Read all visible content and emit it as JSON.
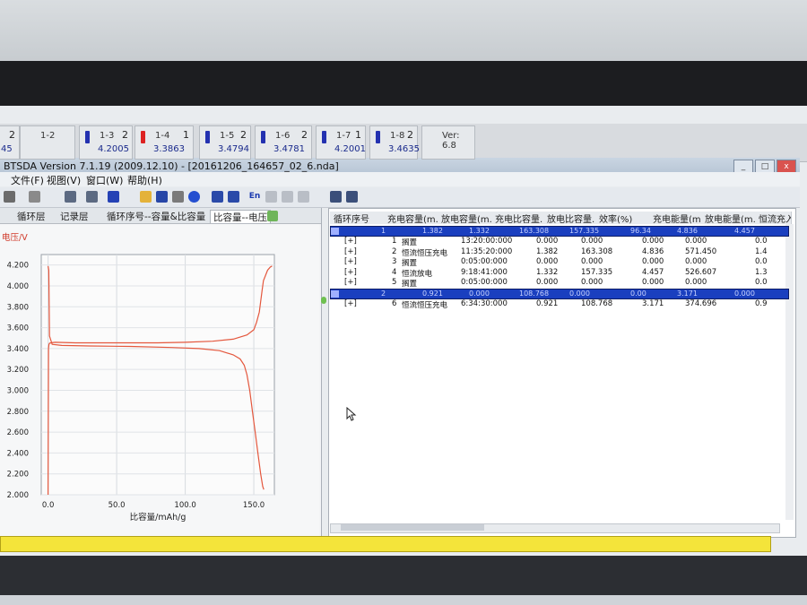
{
  "channel_tabs": [
    {
      "label": "",
      "num": "2",
      "volt": "45",
      "battery": "none"
    },
    {
      "label": "1-2",
      "num": "",
      "volt": "",
      "battery": "none"
    },
    {
      "label": "1-3",
      "num": "2",
      "volt": "4.2005",
      "battery": "blue"
    },
    {
      "label": "1-4",
      "num": "1",
      "volt": "3.3863",
      "battery": "red"
    },
    {
      "label": "1-5",
      "num": "2",
      "volt": "3.4794",
      "battery": "blue"
    },
    {
      "label": "1-6",
      "num": "2",
      "volt": "3.4781",
      "battery": "blue"
    },
    {
      "label": "1-7",
      "num": "1",
      "volt": "4.2001",
      "battery": "blue"
    },
    {
      "label": "1-8",
      "num": "2",
      "volt": "3.4635",
      "battery": "blue"
    },
    {
      "label": "Ver: 6.8",
      "num": "",
      "volt": "",
      "battery": "none"
    }
  ],
  "window": {
    "title": "BTSDA Version 7.1.19 (2009.12.10)   - [20161206_164657_02_6.nda]",
    "min": "_",
    "max": "□",
    "close": "x"
  },
  "menu": [
    "文件(F)",
    "视图(V)",
    "窗口(W)",
    "帮助(H)"
  ],
  "tabs": [
    "循环层",
    "记录层",
    "循环序号--容量&比容量",
    "比容量--电压"
  ],
  "active_tab": 3,
  "table": {
    "headers": [
      "循环序号",
      "充电容量(m...",
      "放电容量(m...",
      "充电比容量...",
      "放电比容量...",
      "效率(%)",
      "充电能量(m...",
      "放电能量(m...",
      "恒流充入比"
    ],
    "cycles": [
      {
        "summary": [
          "1",
          "1.382",
          "1.332",
          "163.308",
          "157.335",
          "96.34",
          "4.836",
          "4.457"
        ],
        "steps": [
          {
            "expand": "[+]",
            "idx": "1",
            "name": "搁置",
            "time": "13:20:00:000",
            "v1": "0.000",
            "v2": "0.000",
            "v3": "0.000",
            "v4": "0.000",
            "v5": "0.0"
          },
          {
            "expand": "[+]",
            "idx": "2",
            "name": "恒流恒压充电",
            "time": "11:35:20:000",
            "v1": "1.382",
            "v2": "163.308",
            "v3": "4.836",
            "v4": "571.450",
            "v5": "1.4"
          },
          {
            "expand": "[+]",
            "idx": "3",
            "name": "搁置",
            "time": "0:05:00:000",
            "v1": "0.000",
            "v2": "0.000",
            "v3": "0.000",
            "v4": "0.000",
            "v5": "0.0"
          },
          {
            "expand": "[+]",
            "idx": "4",
            "name": "恒流放电",
            "time": "9:18:41:000",
            "v1": "1.332",
            "v2": "157.335",
            "v3": "4.457",
            "v4": "526.607",
            "v5": "1.3"
          },
          {
            "expand": "[+]",
            "idx": "5",
            "name": "搁置",
            "time": "0:05:00:000",
            "v1": "0.000",
            "v2": "0.000",
            "v3": "0.000",
            "v4": "0.000",
            "v5": "0.0"
          }
        ]
      },
      {
        "summary": [
          "2",
          "0.921",
          "0.000",
          "108.768",
          "0.000",
          "0.00",
          "3.171",
          "0.000"
        ],
        "steps": [
          {
            "expand": "[+]",
            "idx": "6",
            "name": "恒流恒压充电",
            "time": "6:34:30:000",
            "v1": "0.921",
            "v2": "108.768",
            "v3": "3.171",
            "v4": "374.696",
            "v5": "0.9"
          }
        ]
      }
    ]
  },
  "chart_data": {
    "type": "line",
    "title": "",
    "xlabel": "比容量/mAh/g",
    "ylabel": "电压/V",
    "xlim": [
      -5,
      165
    ],
    "ylim": [
      2.0,
      4.3
    ],
    "x_ticks": [
      "0.0",
      "50.0",
      "100.0",
      "150.0"
    ],
    "x_tick_values": [
      0,
      50,
      100,
      150
    ],
    "y_ticks": [
      "4.200",
      "4.000",
      "3.800",
      "3.600",
      "3.400",
      "3.200",
      "3.000",
      "2.800",
      "2.600",
      "2.400",
      "2.200",
      "2.000"
    ],
    "y_tick_values": [
      4.2,
      4.0,
      3.8,
      3.6,
      3.4,
      3.2,
      3.0,
      2.8,
      2.6,
      2.4,
      2.2,
      2.0
    ],
    "grid": true,
    "line_color": "#e4573d",
    "series": [
      {
        "name": "",
        "x": [
          0,
          0.3,
          0.6,
          1,
          2,
          5,
          20,
          50,
          80,
          100,
          120,
          135,
          145,
          150,
          152,
          154,
          155,
          156,
          157,
          160,
          162,
          163.3,
          163.3
        ],
        "y": [
          2.0,
          3.4,
          3.44,
          3.45,
          3.455,
          3.46,
          3.455,
          3.455,
          3.455,
          3.46,
          3.47,
          3.49,
          3.53,
          3.58,
          3.65,
          3.75,
          3.85,
          3.95,
          4.05,
          4.15,
          4.18,
          4.19,
          4.19
        ]
      },
      {
        "name": "",
        "x": [
          0,
          0.5,
          1,
          3,
          10,
          30,
          60,
          90,
          110,
          125,
          135,
          140,
          143,
          145,
          147,
          149,
          151,
          153,
          155,
          156.5,
          157.3
        ],
        "y": [
          4.19,
          4.15,
          3.52,
          3.44,
          3.43,
          3.425,
          3.42,
          3.41,
          3.4,
          3.38,
          3.34,
          3.3,
          3.24,
          3.15,
          3.0,
          2.8,
          2.6,
          2.4,
          2.2,
          2.08,
          2.05
        ]
      }
    ]
  },
  "status": "",
  "pointer": "cursor-icon"
}
